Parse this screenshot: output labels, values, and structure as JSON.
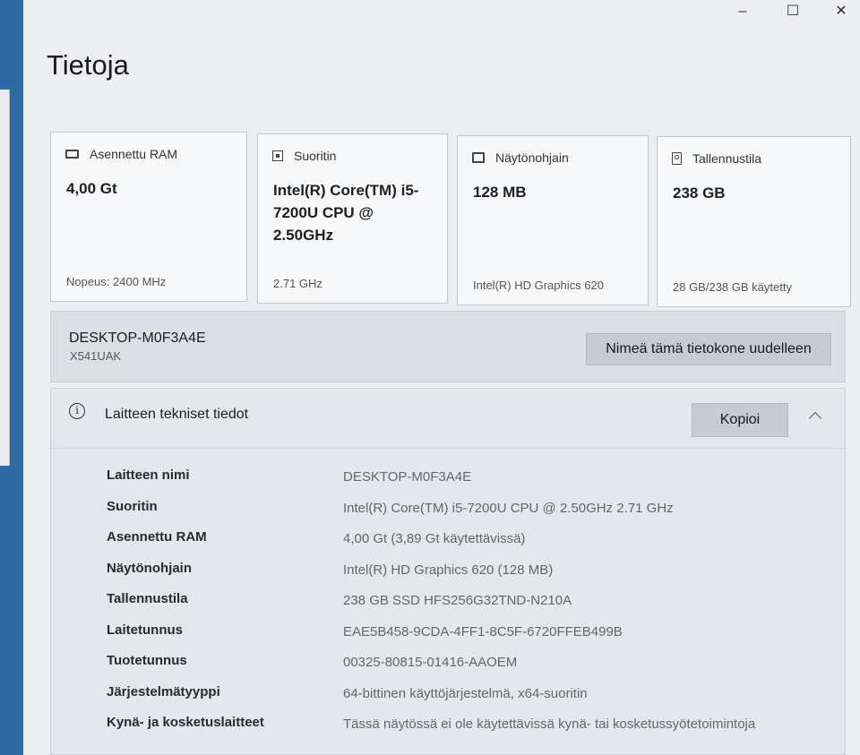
{
  "window": {
    "controls": {
      "minimize": "–",
      "maximize": "☐",
      "close": "✕"
    }
  },
  "page": {
    "title": "Tietoja"
  },
  "cards": [
    {
      "icon": "ram-icon",
      "label": "Asennettu RAM",
      "value": "4,00 Gt",
      "footer": "Nopeus: 2400 MHz"
    },
    {
      "icon": "cpu-icon",
      "label": "Suoritin",
      "value": "Intel(R) Core(TM) i5-7200U CPU @ 2.50GHz",
      "footer": "2.71 GHz"
    },
    {
      "icon": "gpu-icon",
      "label": "Näytönohjain",
      "value": "128 MB",
      "footer": "Intel(R) HD Graphics 620"
    },
    {
      "icon": "storage-icon",
      "label": "Tallennustila",
      "value": "238 GB",
      "footer": "28 GB/238 GB käytetty"
    }
  ],
  "device": {
    "name": "DESKTOP-M0F3A4E",
    "model": "X541UAK",
    "rename_label": "Nimeä tämä tietokone uudelleen"
  },
  "specs": {
    "title": "Laitteen tekniset tiedot",
    "copy_label": "Kopioi",
    "rows": [
      {
        "label": "Laitteen nimi",
        "value": "DESKTOP-M0F3A4E"
      },
      {
        "label": "Suoritin",
        "value": "Intel(R) Core(TM) i5-7200U CPU @ 2.50GHz   2.71 GHz"
      },
      {
        "label": "Asennettu RAM",
        "value": "4,00 Gt (3,89 Gt käytettävissä)"
      },
      {
        "label": "Näytönohjain",
        "value": "Intel(R) HD Graphics 620 (128 MB)"
      },
      {
        "label": "Tallennustila",
        "value": "238 GB SSD HFS256G32TND-N210A"
      },
      {
        "label": "Laitetunnus",
        "value": "EAE5B458-9CDA-4FF1-8C5F-6720FFEB499B"
      },
      {
        "label": "Tuotetunnus",
        "value": "00325-80815-01416-AAOEM"
      },
      {
        "label": "Järjestelmätyyppi",
        "value": "64-bittinen käyttöjärjestelmä, x64-suoritin"
      },
      {
        "label": "Kynä- ja kosketuslaitteet",
        "value": "Tässä näytössä ei ole käytettävissä kynä- tai kosketussyötetoimintoja"
      }
    ]
  }
}
